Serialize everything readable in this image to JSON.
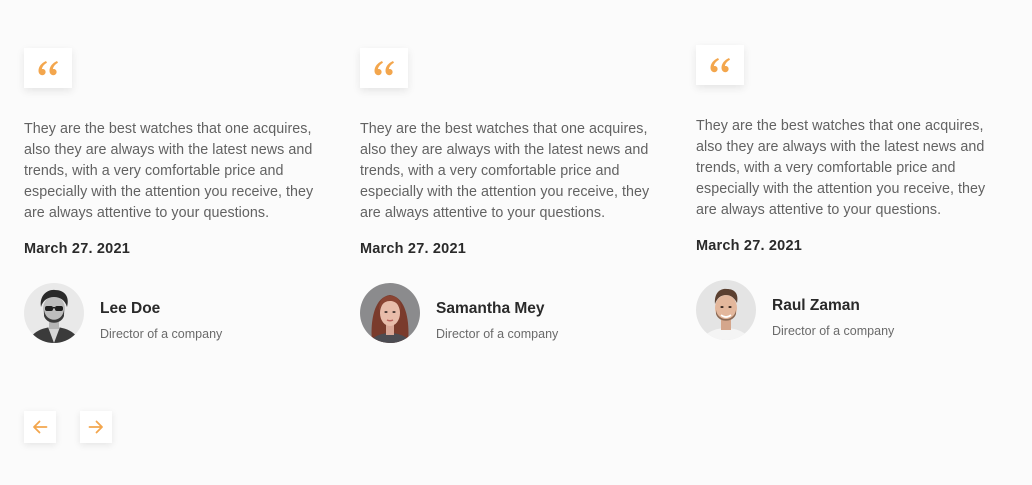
{
  "theme": {
    "accent": "#f3a64d",
    "background": "#fbfbfb"
  },
  "testimonials": [
    {
      "quote_icon": "quote-icon",
      "text": "They are the best watches that one acquires, also they are always with the latest news and trends, with a very comfortable price and especially with the attention you receive, they are always attentive to your questions.",
      "date": "March 27. 2021",
      "name": "Lee Doe",
      "role": "Director of a company"
    },
    {
      "quote_icon": "quote-icon",
      "text": "They are the best watches that one acquires, also they are always with the latest news and trends, with a very comfortable price and especially with the attention you receive, they are always attentive to your questions.",
      "date": "March 27. 2021",
      "name": "Samantha Mey",
      "role": "Director of a company"
    },
    {
      "quote_icon": "quote-icon",
      "text": "They are the best watches that one acquires, also they are always with the latest news and trends, with a very comfortable price and especially with the attention you receive, they are always attentive to your questions.",
      "date": "March 27. 2021",
      "name": "Raul Zaman",
      "role": "Director of a company"
    }
  ],
  "navigation": {
    "prev_icon": "arrow-left-icon",
    "next_icon": "arrow-right-icon"
  }
}
